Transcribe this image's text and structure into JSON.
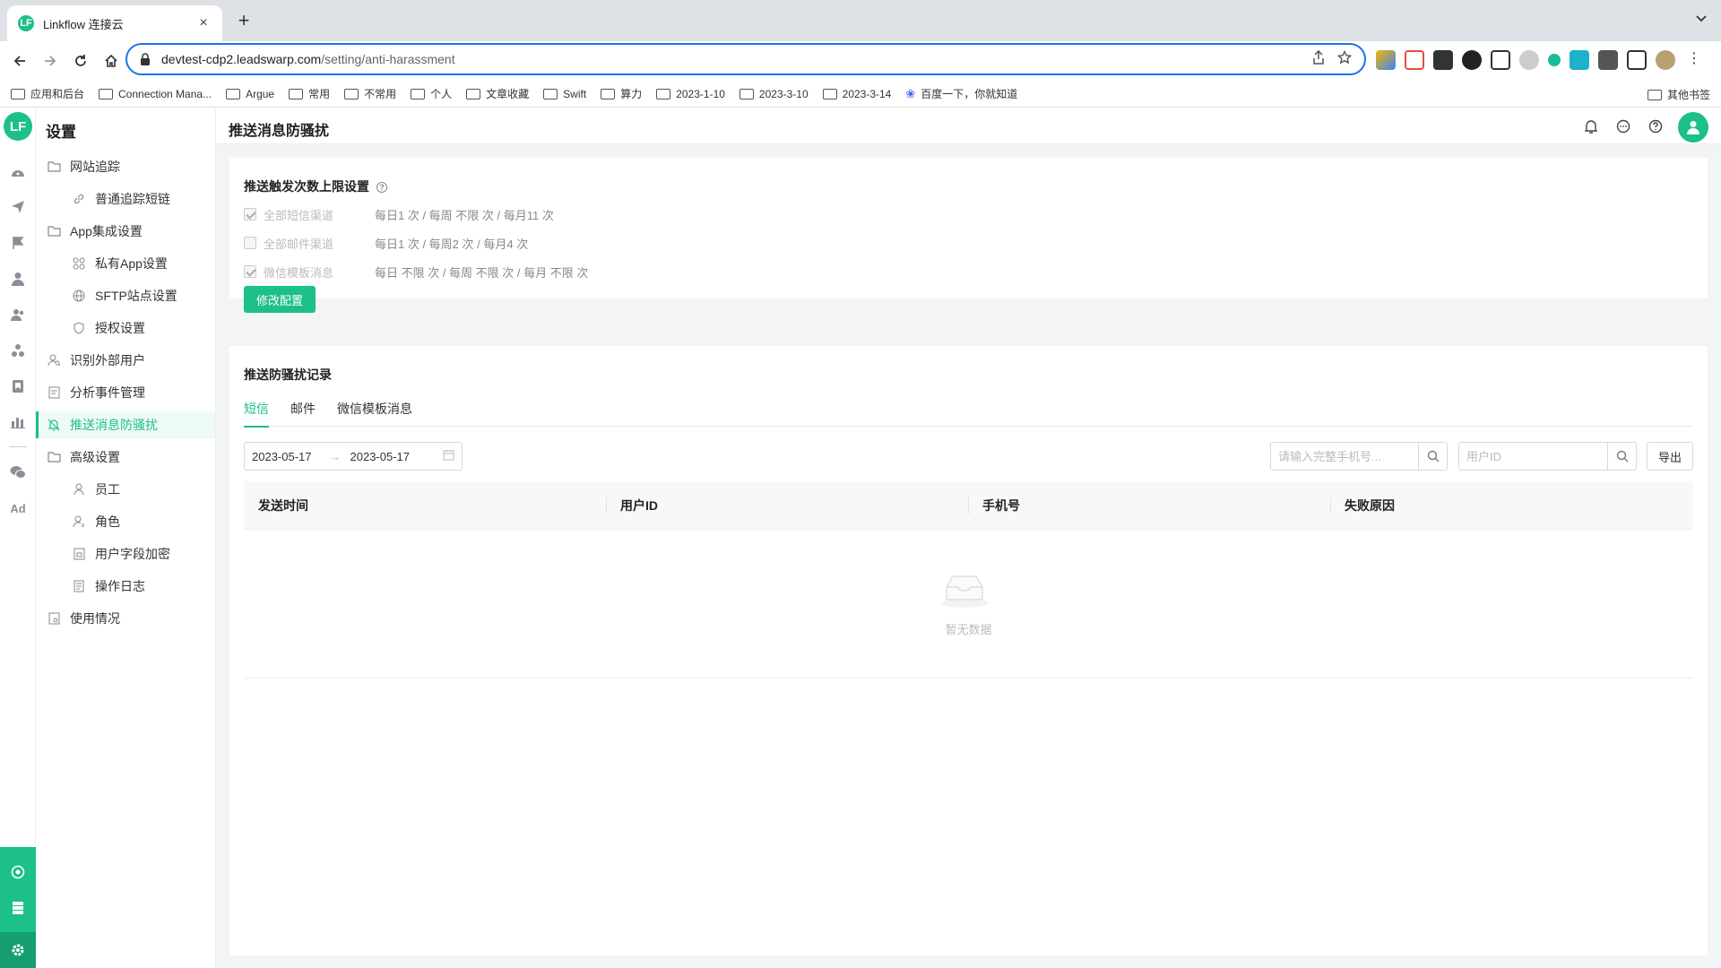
{
  "browser": {
    "tab_title": "Linkflow 连接云",
    "tab_favicon": "LF",
    "url_host": "devtest-cdp2.leadswarp.com",
    "url_path": "/setting/anti-harassment",
    "bookmarks": [
      "应用和后台",
      "Connection Mana...",
      "Argue",
      "常用",
      "不常用",
      "个人",
      "文章收藏",
      "Swift",
      "算力",
      "2023-1-10",
      "2023-3-10",
      "2023-3-14"
    ],
    "baidu_bookmark": "百度一下，你就知道",
    "other_bookmarks": "其他书签"
  },
  "app": {
    "logo": "LF",
    "accent": "#1dbf8a",
    "rail_ad_label": "Ad",
    "sidebar": {
      "title": "设置",
      "items": [
        {
          "label": "网站追踪",
          "icon": "folder-icon",
          "level": 0
        },
        {
          "label": "普通追踪短链",
          "icon": "link-icon",
          "level": 1
        },
        {
          "label": "App集成设置",
          "icon": "folder-icon",
          "level": 0
        },
        {
          "label": "私有App设置",
          "icon": "apps-icon",
          "level": 1
        },
        {
          "label": "SFTP站点设置",
          "icon": "globe-icon",
          "level": 1
        },
        {
          "label": "授权设置",
          "icon": "shield-icon",
          "level": 1
        },
        {
          "label": "识别外部用户",
          "icon": "user-search-icon",
          "level": 0
        },
        {
          "label": "分析事件管理",
          "icon": "event-icon",
          "level": 0
        },
        {
          "label": "推送消息防骚扰",
          "icon": "bell-off-icon",
          "level": 0,
          "active": true
        },
        {
          "label": "高级设置",
          "icon": "folder-icon",
          "level": 0
        },
        {
          "label": "员工",
          "icon": "user-icon",
          "level": 1
        },
        {
          "label": "角色",
          "icon": "role-icon",
          "level": 1
        },
        {
          "label": "用户字段加密",
          "icon": "encrypt-icon",
          "level": 1
        },
        {
          "label": "操作日志",
          "icon": "log-icon",
          "level": 1
        },
        {
          "label": "使用情况",
          "icon": "usage-icon",
          "level": 0
        }
      ]
    },
    "header": {
      "title": "推送消息防骚扰"
    },
    "limit_card": {
      "title": "推送触发次数上限设置",
      "rows": [
        {
          "label": "全部短信渠道",
          "value": "每日1 次 / 每周 不限 次 / 每月11 次",
          "checked": true
        },
        {
          "label": "全部邮件渠道",
          "value": "每日1 次 / 每周2 次 / 每月4 次",
          "checked": false
        },
        {
          "label": "微信模板消息",
          "value": "每日 不限 次 / 每周 不限 次 / 每月 不限 次",
          "checked": true
        }
      ],
      "edit_button": "修改配置"
    },
    "records": {
      "title": "推送防骚扰记录",
      "tabs": [
        "短信",
        "邮件",
        "微信模板消息"
      ],
      "active_tab": 0,
      "date_start": "2023-05-17",
      "date_end": "2023-05-17",
      "phone_placeholder": "请输入完整手机号...",
      "userid_placeholder": "用户ID",
      "export_button": "导出",
      "columns": [
        "发送时间",
        "用户ID",
        "手机号",
        "失败原因"
      ],
      "empty_text": "暂无数据"
    }
  }
}
